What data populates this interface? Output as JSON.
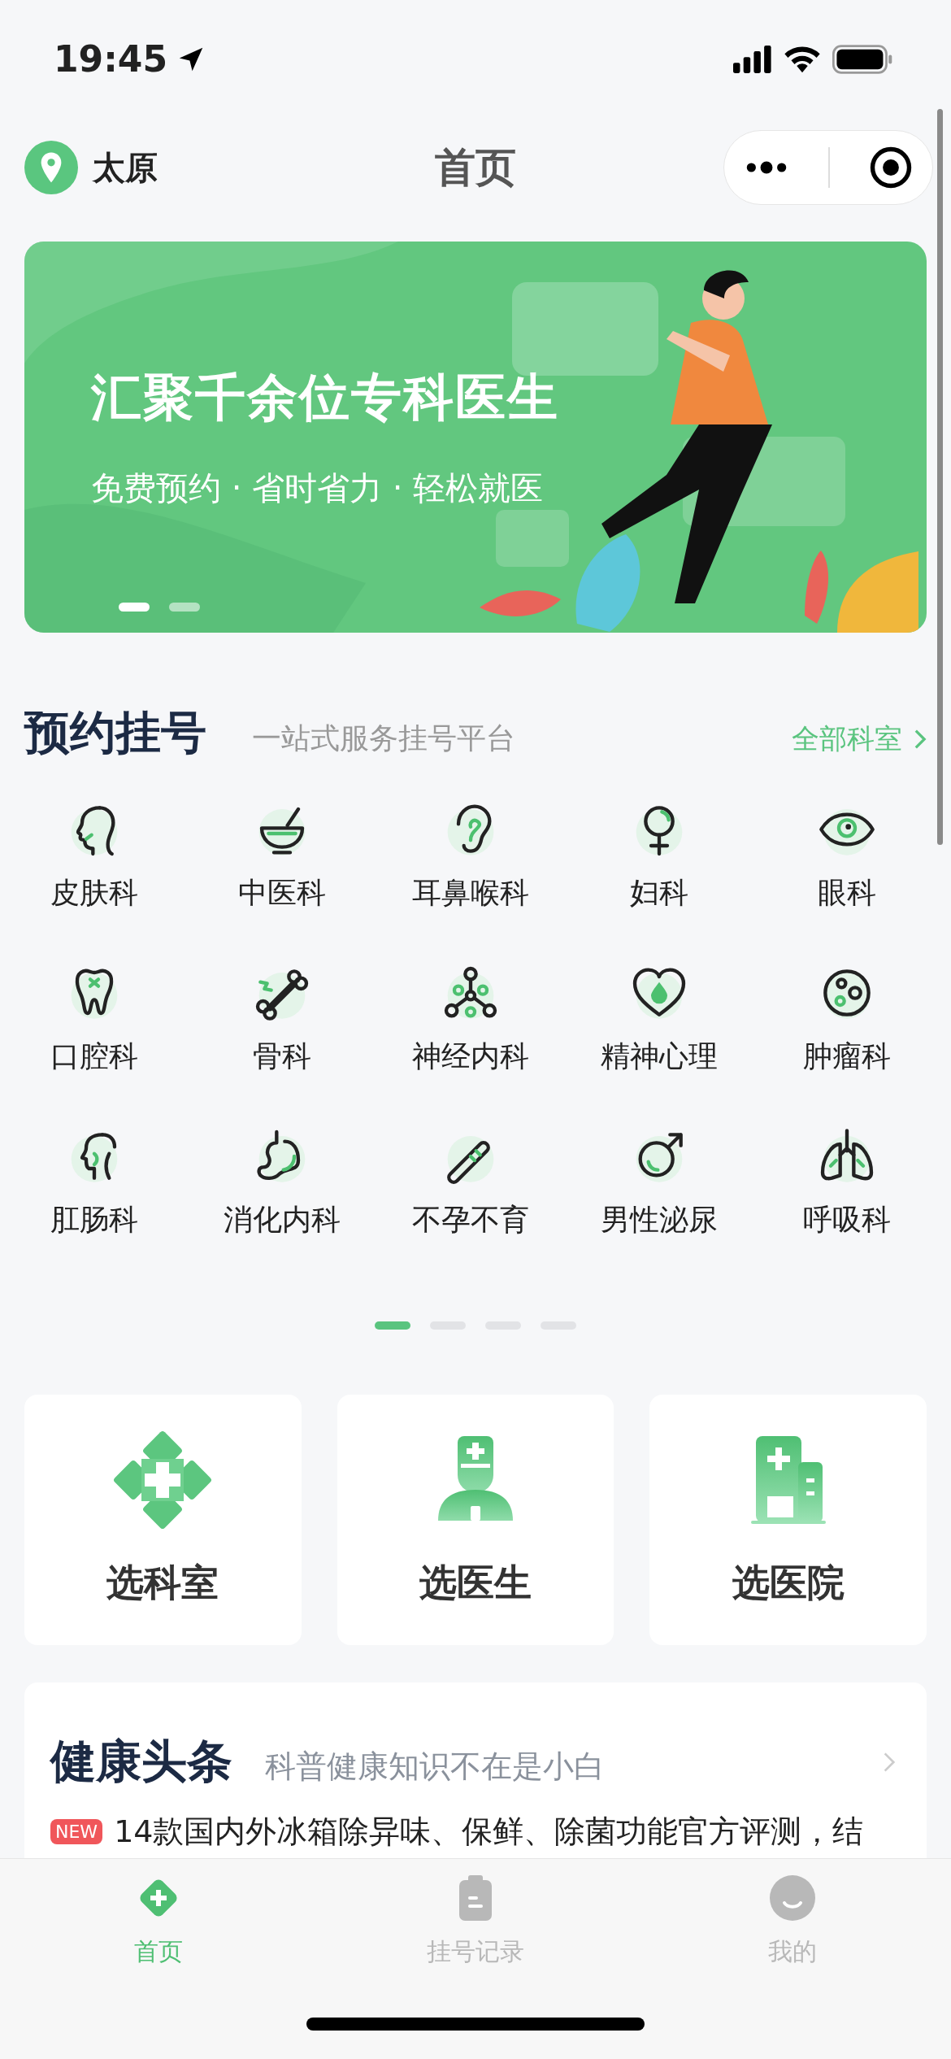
{
  "status_bar": {
    "time": "19:45"
  },
  "nav": {
    "city": "太原",
    "title": "首页"
  },
  "banner": {
    "title": "汇聚千余位专科医生",
    "subtitle": "免费预约 · 省时省力 · 轻松就医",
    "dots": [
      {
        "selected": true
      },
      {
        "selected": false
      }
    ]
  },
  "booking": {
    "title": "预约挂号",
    "subtitle": "一站式服务挂号平台",
    "link": "全部科室",
    "departments": [
      {
        "label": "皮肤科"
      },
      {
        "label": "中医科"
      },
      {
        "label": "耳鼻喉科"
      },
      {
        "label": "妇科"
      },
      {
        "label": "眼科"
      },
      {
        "label": "口腔科"
      },
      {
        "label": "骨科"
      },
      {
        "label": "神经内科"
      },
      {
        "label": "精神心理"
      },
      {
        "label": "肿瘤科"
      },
      {
        "label": "肛肠科"
      },
      {
        "label": "消化内科"
      },
      {
        "label": "不孕不育"
      },
      {
        "label": "男性泌尿"
      },
      {
        "label": "呼吸科"
      }
    ],
    "pages": [
      {
        "selected": true
      },
      {
        "selected": false
      },
      {
        "selected": false
      },
      {
        "selected": false
      }
    ]
  },
  "entries": [
    {
      "label": "选科室"
    },
    {
      "label": "选医生"
    },
    {
      "label": "选医院"
    }
  ],
  "headlines": {
    "title": "健康头条",
    "subtitle": "科普健康知识不在是小白",
    "items": [
      {
        "badge": "NEW",
        "text": "14款国内外冰箱除异味、保鲜、除菌功能官方评测，结"
      }
    ]
  },
  "tabs": [
    {
      "label": "首页",
      "selected": true
    },
    {
      "label": "挂号记录",
      "selected": false
    },
    {
      "label": "我的",
      "selected": false
    }
  ]
}
